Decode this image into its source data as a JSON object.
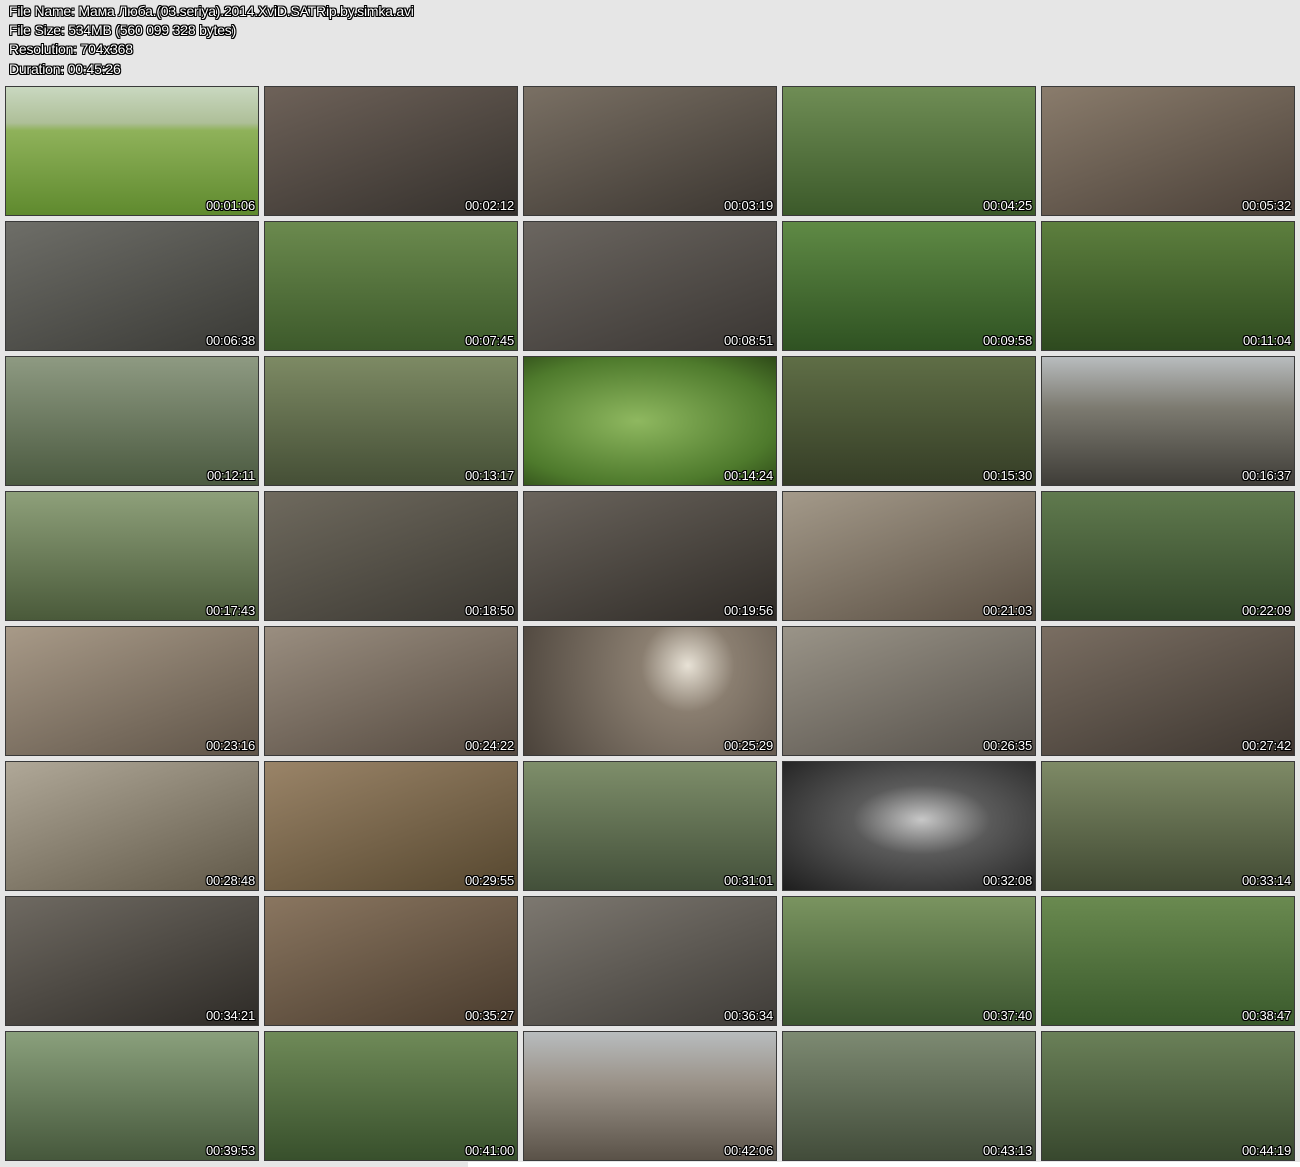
{
  "file_info": {
    "file_name": "File Name: Мама Люба.(03.seriya).2014.XviD.SATRip.by.simka.avi",
    "file_size": "File Size: 534MB (560 099 328 bytes)",
    "resolution": "Resolution: 704x368",
    "duration": "Duration: 00:45:26"
  },
  "thumbnails": [
    {
      "time": "00:01:06",
      "scene": "meadow",
      "c1": "#8fb25a",
      "c2": "#5f8a2e"
    },
    {
      "time": "00:02:12",
      "scene": "indoor",
      "c1": "#6e6259",
      "c2": "#34302c"
    },
    {
      "time": "00:03:19",
      "scene": "indoor",
      "c1": "#7a7064",
      "c2": "#3a3530"
    },
    {
      "time": "00:04:25",
      "scene": "garden",
      "c1": "#6f8d55",
      "c2": "#3c5a2a"
    },
    {
      "time": "00:05:32",
      "scene": "indoor",
      "c1": "#8a7c6c",
      "c2": "#4a4038"
    },
    {
      "time": "00:06:38",
      "scene": "indoor",
      "c1": "#6e6e68",
      "c2": "#3a3a36"
    },
    {
      "time": "00:07:45",
      "scene": "garden",
      "c1": "#6b8a4e",
      "c2": "#3d5a2b"
    },
    {
      "time": "00:08:51",
      "scene": "indoor",
      "c1": "#6b6660",
      "c2": "#3a3633"
    },
    {
      "time": "00:09:58",
      "scene": "garden",
      "c1": "#5f8a45",
      "c2": "#2f5222"
    },
    {
      "time": "00:11:04",
      "scene": "garden",
      "c1": "#5d7f3e",
      "c2": "#2e4a1f"
    },
    {
      "time": "00:12:11",
      "scene": "garden",
      "c1": "#8e9a82",
      "c2": "#4b5a40"
    },
    {
      "time": "00:13:17",
      "scene": "garden",
      "c1": "#7d8a64",
      "c2": "#454f36"
    },
    {
      "time": "00:14:24",
      "scene": "leaf",
      "c1": "#8fb860",
      "c2": "#4e7a2c"
    },
    {
      "time": "00:15:30",
      "scene": "garden",
      "c1": "#5f6e46",
      "c2": "#353d26"
    },
    {
      "time": "00:16:37",
      "scene": "outdoor",
      "c1": "#7c7a70",
      "c2": "#3f3d38"
    },
    {
      "time": "00:17:43",
      "scene": "garden",
      "c1": "#8ea07a",
      "c2": "#4a5a3a"
    },
    {
      "time": "00:18:50",
      "scene": "indoor",
      "c1": "#6f6a5e",
      "c2": "#3b3832"
    },
    {
      "time": "00:19:56",
      "scene": "indoor",
      "c1": "#6a645c",
      "c2": "#2f2b27"
    },
    {
      "time": "00:21:03",
      "scene": "indoor",
      "c1": "#a49a8a",
      "c2": "#5a4f43"
    },
    {
      "time": "00:22:09",
      "scene": "garden",
      "c1": "#607a4e",
      "c2": "#33472a"
    },
    {
      "time": "00:23:16",
      "scene": "indoor",
      "c1": "#a89a88",
      "c2": "#5f5448"
    },
    {
      "time": "00:24:22",
      "scene": "indoor",
      "c1": "#9a8e80",
      "c2": "#54493f"
    },
    {
      "time": "00:25:29",
      "scene": "studio",
      "c1": "#8a7e70",
      "c2": "#4a423a"
    },
    {
      "time": "00:26:35",
      "scene": "indoor",
      "c1": "#9a9488",
      "c2": "#55504a"
    },
    {
      "time": "00:27:42",
      "scene": "indoor",
      "c1": "#7a6e62",
      "c2": "#3d3630"
    },
    {
      "time": "00:28:48",
      "scene": "indoor",
      "c1": "#b0a898",
      "c2": "#605848"
    },
    {
      "time": "00:29:55",
      "scene": "indoor",
      "c1": "#9a8468",
      "c2": "#56472f"
    },
    {
      "time": "00:31:01",
      "scene": "garden",
      "c1": "#7e8e6a",
      "c2": "#43503a"
    },
    {
      "time": "00:32:08",
      "scene": "car",
      "c1": "#5a5a5a",
      "c2": "#1e1e1e"
    },
    {
      "time": "00:33:14",
      "scene": "garden",
      "c1": "#7e8a66",
      "c2": "#414a33"
    },
    {
      "time": "00:34:21",
      "scene": "indoor",
      "c1": "#6f6a62",
      "c2": "#2e2b27"
    },
    {
      "time": "00:35:27",
      "scene": "indoor",
      "c1": "#8a7660",
      "c2": "#4a3c2e"
    },
    {
      "time": "00:36:34",
      "scene": "indoor",
      "c1": "#7d7870",
      "c2": "#3f3c38"
    },
    {
      "time": "00:37:40",
      "scene": "garden",
      "c1": "#7a9460",
      "c2": "#3c5530"
    },
    {
      "time": "00:38:47",
      "scene": "garden",
      "c1": "#6a8a50",
      "c2": "#3a5a2c"
    },
    {
      "time": "00:39:53",
      "scene": "garden",
      "c1": "#8aa07c",
      "c2": "#46583c"
    },
    {
      "time": "00:41:00",
      "scene": "garden",
      "c1": "#6f8a58",
      "c2": "#38502c"
    },
    {
      "time": "00:42:06",
      "scene": "outdoor",
      "c1": "#9a9288",
      "c2": "#5a5248"
    },
    {
      "time": "00:43:13",
      "scene": "garden",
      "c1": "#7d8a72",
      "c2": "#424c3a"
    },
    {
      "time": "00:44:19",
      "scene": "garden",
      "c1": "#6a8058",
      "c2": "#38482e"
    }
  ]
}
